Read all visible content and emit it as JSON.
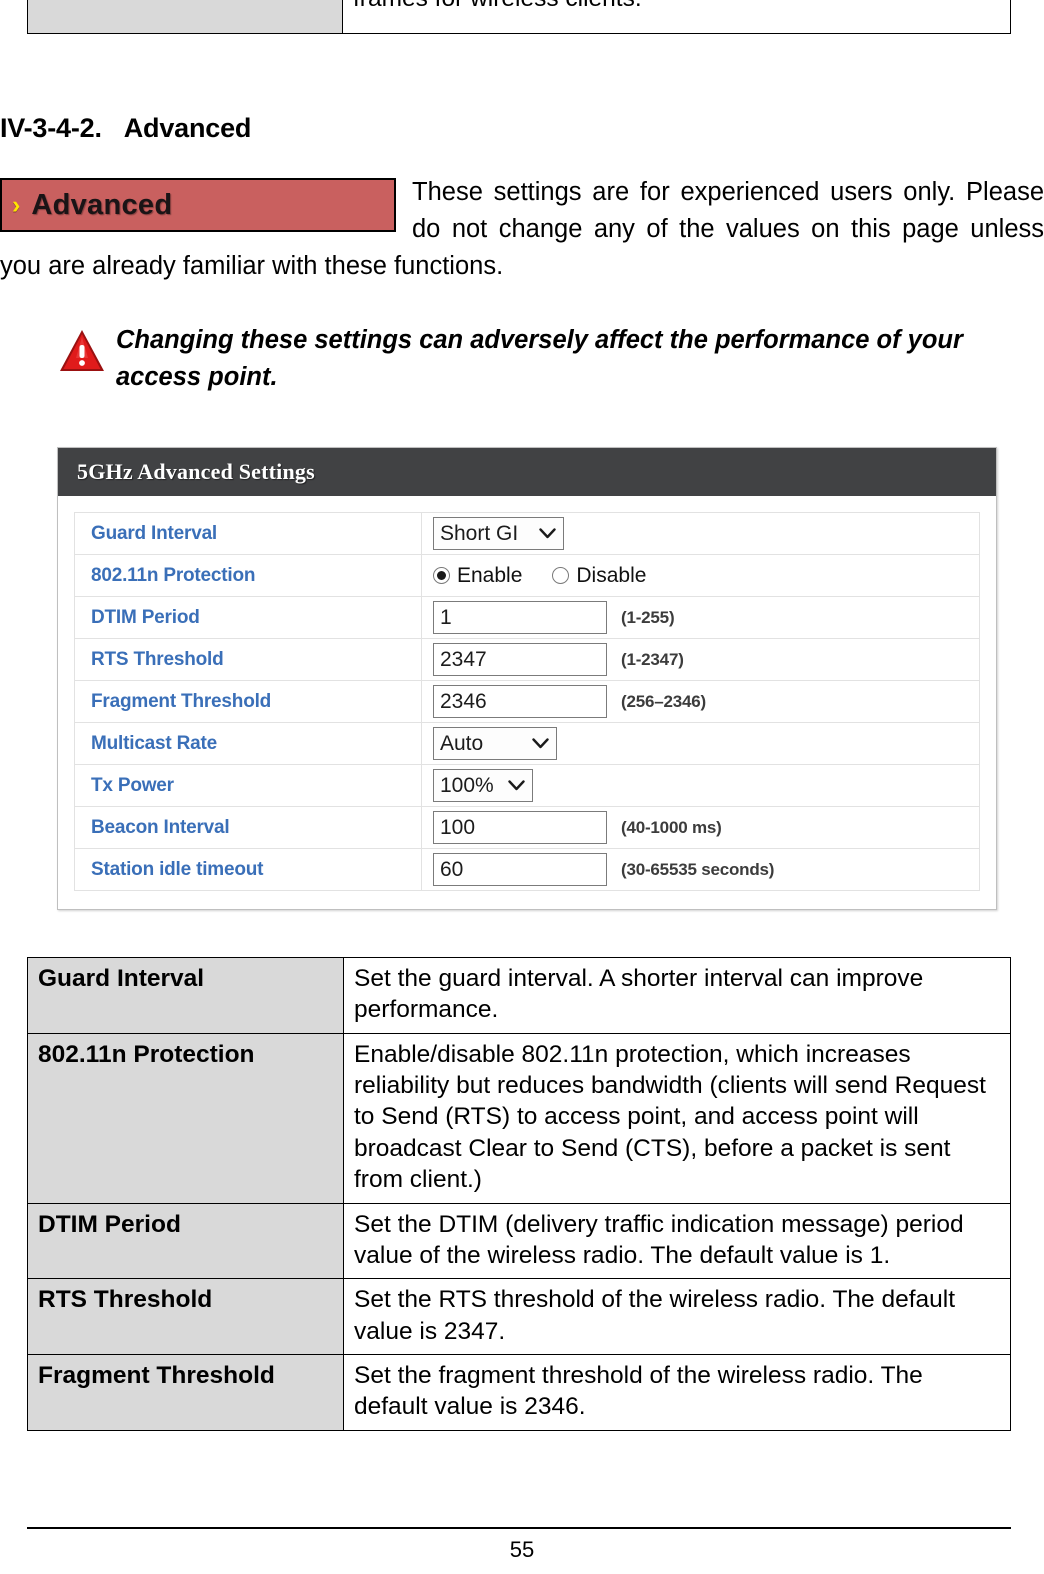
{
  "top_continuation_row": {
    "key": "",
    "value": "frames for wireless clients."
  },
  "section": {
    "number": "IV-3-4-2.",
    "title": "Advanced"
  },
  "advanced_button": {
    "chevron": "›",
    "label": "Advanced",
    "background_color": "#c9605f",
    "chevron_color": "#ffe600"
  },
  "intro_paragraph": "These settings are for experienced users only. Please do not change any of the values on this page unless you are already familiar with these functions.",
  "warning": {
    "icon": "warning-triangle-icon",
    "text": "Changing these settings can adversely affect the performance of your access point."
  },
  "settings_panel": {
    "header": "5GHz Advanced Settings",
    "header_color": "#414244",
    "label_color": "#3a6fb8",
    "rows": [
      {
        "label": "Guard Interval",
        "control": "select",
        "value": "Short GI",
        "hint": ""
      },
      {
        "label": "802.11n Protection",
        "control": "radio",
        "options": [
          {
            "label": "Enable",
            "selected": true
          },
          {
            "label": "Disable",
            "selected": false
          }
        ],
        "hint": ""
      },
      {
        "label": "DTIM Period",
        "control": "text",
        "value": "1",
        "hint": "(1-255)"
      },
      {
        "label": "RTS Threshold",
        "control": "text",
        "value": "2347",
        "hint": "(1-2347)"
      },
      {
        "label": "Fragment Threshold",
        "control": "text",
        "value": "2346",
        "hint": "(256–2346)"
      },
      {
        "label": "Multicast Rate",
        "control": "select",
        "value": "Auto",
        "hint": ""
      },
      {
        "label": "Tx Power",
        "control": "select",
        "value": "100%",
        "hint": ""
      },
      {
        "label": "Beacon Interval",
        "control": "text",
        "value": "100",
        "hint": "(40-1000 ms)"
      },
      {
        "label": "Station idle timeout",
        "control": "text",
        "value": "60",
        "hint": "(30-65535 seconds)"
      }
    ]
  },
  "description_table": {
    "rows": [
      {
        "key": "Guard Interval",
        "value": "Set the guard interval. A shorter interval can improve performance."
      },
      {
        "key": "802.11n Protection",
        "value": "Enable/disable 802.11n protection, which increases reliability but reduces bandwidth (clients will send Request to Send (RTS) to access point, and access point will broadcast Clear to Send (CTS), before a packet is sent from client.)"
      },
      {
        "key": "DTIM Period",
        "value": "Set the DTIM (delivery traffic indication message) period value of the wireless radio. The default value is 1."
      },
      {
        "key": "RTS Threshold",
        "value": "Set the RTS threshold of the wireless radio. The default value is 2347."
      },
      {
        "key": "Fragment Threshold",
        "value": "Set the fragment threshold of the wireless radio. The default value is 2346."
      }
    ]
  },
  "footer": {
    "page_number": "55"
  }
}
